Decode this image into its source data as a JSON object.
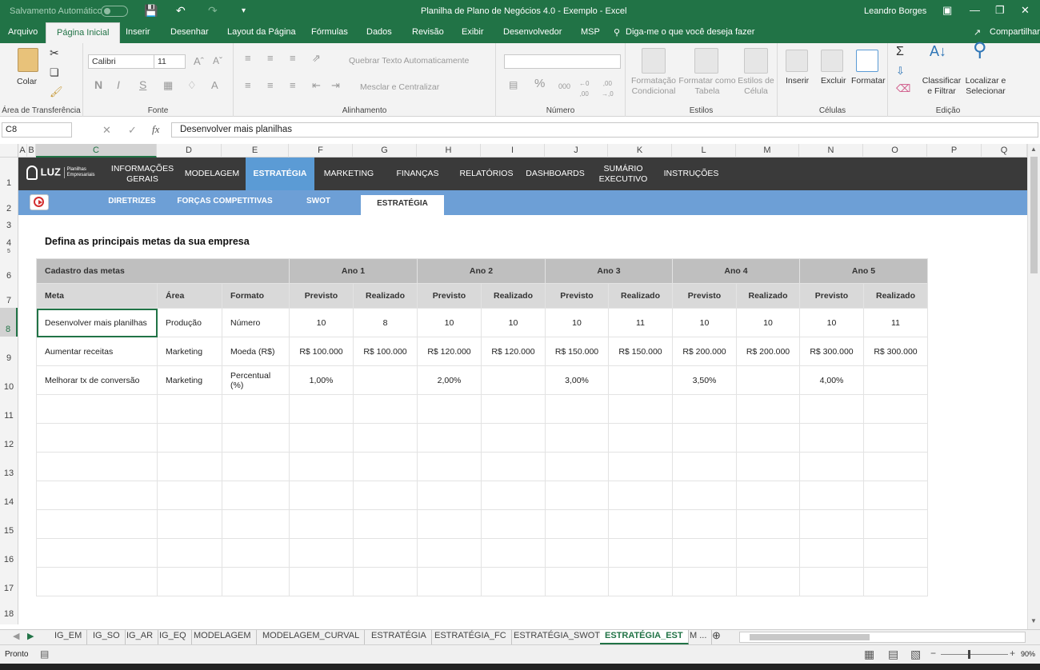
{
  "titlebar": {
    "autosave": "Salvamento Automático",
    "title": "Planilha de Plano de Negócios 4.0 - Exemplo  -  Excel",
    "user": "Leandro Borges"
  },
  "ribbon_tabs": [
    "Arquivo",
    "Página Inicial",
    "Inserir",
    "Desenhar",
    "Layout da Página",
    "Fórmulas",
    "Dados",
    "Revisão",
    "Exibir",
    "Desenvolvedor",
    "MSP"
  ],
  "tell_me": "Diga-me o que você deseja fazer",
  "share": "Compartilhar",
  "ribbon": {
    "clipboard": {
      "paste": "Colar",
      "group": "Área de Transferência"
    },
    "font": {
      "name": "Calibri",
      "size": "11",
      "group": "Fonte",
      "bold": "N",
      "italic": "I",
      "underline": "S"
    },
    "alignment": {
      "wrap": "Quebrar Texto Automaticamente",
      "merge": "Mesclar e Centralizar",
      "group": "Alinhamento"
    },
    "number": {
      "group": "Número",
      "percent": "%",
      "thousands": "000"
    },
    "styles": {
      "cond": "Formatação Condicional",
      "table": "Formatar como Tabela",
      "cell": "Estilos de Célula",
      "group": "Estilos"
    },
    "cells": {
      "insert": "Inserir",
      "delete": "Excluir",
      "format": "Formatar",
      "group": "Células"
    },
    "editing": {
      "sort": "Classificar e Filtrar",
      "find": "Localizar e Selecionar",
      "group": "Edição"
    }
  },
  "formula_bar": {
    "cell": "C8",
    "formula": "Desenvolver mais planilhas"
  },
  "columns": [
    "A",
    "B",
    "C",
    "D",
    "E",
    "F",
    "G",
    "H",
    "I",
    "J",
    "K",
    "L",
    "M",
    "N",
    "O",
    "P",
    "Q"
  ],
  "rows": [
    "1",
    "2",
    "3",
    "4",
    "5",
    "6",
    "7",
    "8",
    "9",
    "10",
    "11",
    "12",
    "13",
    "14",
    "15",
    "16",
    "17",
    "18"
  ],
  "nav": {
    "logo": "LUZ",
    "logo_sub": "Planilhas Empresariais",
    "items": [
      "INFORMAÇÕES GERAIS",
      "MODELAGEM",
      "ESTRATÉGIA",
      "MARKETING",
      "FINANÇAS",
      "RELATÓRIOS",
      "DASHBOARDS",
      "SUMÁRIO EXECUTIVO",
      "INSTRUÇÕES"
    ],
    "sub": [
      "DIRETRIZES",
      "FORÇAS COMPETITIVAS",
      "SWOT",
      "ESTRATÉGIA"
    ]
  },
  "heading": "Defina as principais metas da sua empresa",
  "table": {
    "title": "Cadastro das metas",
    "years": [
      "Ano 1",
      "Ano 2",
      "Ano 3",
      "Ano 4",
      "Ano 5"
    ],
    "headers": [
      "Meta",
      "Área",
      "Formato"
    ],
    "sub": [
      "Previsto",
      "Realizado"
    ],
    "rows": [
      [
        "Desenvolver mais planilhas",
        "Produção",
        "Número",
        "10",
        "8",
        "10",
        "10",
        "10",
        "11",
        "10",
        "10",
        "10",
        "11"
      ],
      [
        "Aumentar receitas",
        "Marketing",
        "Moeda (R$)",
        "R$ 100.000",
        "R$ 100.000",
        "R$ 120.000",
        "R$ 120.000",
        "R$ 150.000",
        "R$ 150.000",
        "R$ 200.000",
        "R$ 200.000",
        "R$ 300.000",
        "R$ 300.000"
      ],
      [
        "Melhorar tx de conversão",
        "Marketing",
        "Percentual (%)",
        "1,00%",
        "",
        "2,00%",
        "",
        "3,00%",
        "",
        "3,50%",
        "",
        "4,00%",
        ""
      ]
    ]
  },
  "sheet_tabs": [
    "IG_EM",
    "IG_SO",
    "IG_AR",
    "IG_EQ",
    "MODELAGEM",
    "MODELAGEM_CURVAL",
    "ESTRATÉGIA",
    "ESTRATÉGIA_FC",
    "ESTRATÉGIA_SWOT",
    "ESTRATÉGIA_EST",
    "M ..."
  ],
  "status": {
    "ready": "Pronto",
    "zoom": "90%"
  }
}
